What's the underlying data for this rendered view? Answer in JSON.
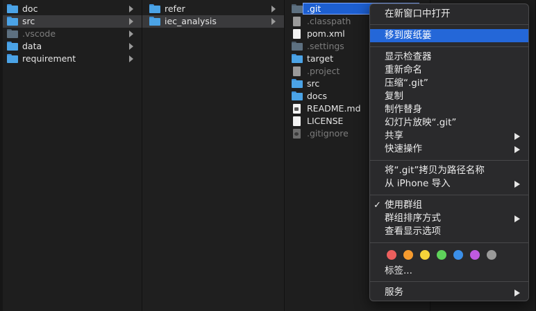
{
  "columns": {
    "col1": [
      {
        "label": "doc",
        "icon": "folder-icon",
        "has_children": true
      },
      {
        "label": "src",
        "icon": "folder-icon",
        "has_children": true,
        "selected": true
      },
      {
        "label": ".vscode",
        "icon": "folder-icon",
        "has_children": true,
        "dimmed": true
      },
      {
        "label": "data",
        "icon": "folder-icon",
        "has_children": true
      },
      {
        "label": "requirement",
        "icon": "folder-icon",
        "has_children": true
      }
    ],
    "col2": [
      {
        "label": "refer",
        "icon": "folder-icon",
        "has_children": true
      },
      {
        "label": "iec_analysis",
        "icon": "folder-icon",
        "has_children": true,
        "selected": true
      }
    ],
    "col3": [
      {
        "label": ".git",
        "icon": "folder-icon",
        "focused": true
      },
      {
        "label": ".classpath",
        "icon": "document-icon",
        "dimmed": true
      },
      {
        "label": "pom.xml",
        "icon": "document-icon"
      },
      {
        "label": ".settings",
        "icon": "folder-icon",
        "dimmed": true
      },
      {
        "label": "target",
        "icon": "folder-icon"
      },
      {
        "label": ".project",
        "icon": "document-icon",
        "dimmed": true
      },
      {
        "label": "src",
        "icon": "folder-icon"
      },
      {
        "label": "docs",
        "icon": "folder-icon"
      },
      {
        "label": "README.md",
        "icon": "markdown-document-icon"
      },
      {
        "label": "LICENSE",
        "icon": "document-icon"
      },
      {
        "label": ".gitignore",
        "icon": "gear-document-icon",
        "dimmed": true
      }
    ]
  },
  "context_menu": {
    "open_new_window": "在新窗口中打开",
    "move_to_trash": "移到废纸篓",
    "show_inspector": "显示检查器",
    "rename": "重新命名",
    "compress": "压缩“.git”",
    "duplicate": "复制",
    "make_alias": "制作替身",
    "slideshow": "幻灯片放映“.git”",
    "share": "共享",
    "quick_actions": "快速操作",
    "copy_as_pathname": "将“.git”拷贝为路径名称",
    "import_from_iphone": "从 iPhone 导入",
    "use_groups": "使用群组",
    "use_groups_check": "✓",
    "group_by": "群组排序方式",
    "show_view_options": "查看显示选项",
    "tags": "标签...",
    "services": "服务",
    "tag_colors": [
      "#ec5f5d",
      "#f59a2e",
      "#f5d33a",
      "#5ed25a",
      "#3b8fe8",
      "#bf5ae0",
      "#9a9a9a"
    ]
  },
  "colors": {
    "accent": "#2467d8",
    "folder": "#4ba3e6"
  }
}
